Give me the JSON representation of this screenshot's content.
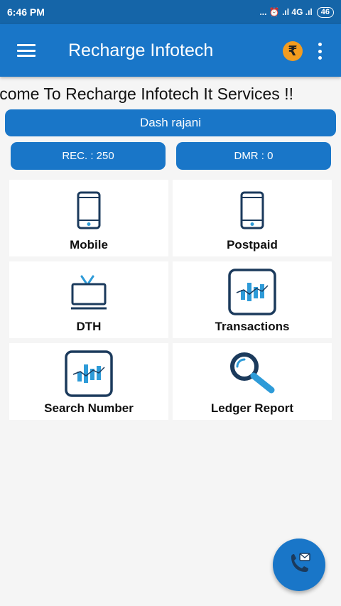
{
  "status_bar": {
    "time": "6:46 PM",
    "indicators": "... ⏰ .ıl 4G .ıl",
    "battery": "46"
  },
  "app_bar": {
    "title": "Recharge Infotech",
    "menu_icon": "hamburger-icon",
    "wallet_icon": "rupee-icon",
    "wallet_symbol": "₹",
    "more_icon": "more-vert-icon"
  },
  "marquee": {
    "text": "Welcome To Recharge Infotech It Services !!"
  },
  "user": {
    "name": "Dash rajani"
  },
  "balances": {
    "rec": "REC. : 250",
    "dmr": "DMR : 0"
  },
  "tiles": [
    {
      "label": "Mobile",
      "icon": "mobile-phone-icon"
    },
    {
      "label": "Postpaid",
      "icon": "mobile-phone-icon"
    },
    {
      "label": "DTH",
      "icon": "tv-icon"
    },
    {
      "label": "Transactions",
      "icon": "chart-icon"
    },
    {
      "label": "Search Number",
      "icon": "chart-icon"
    },
    {
      "label": "Ledger Report",
      "icon": "magnifier-icon"
    }
  ],
  "fab": {
    "icon": "phone-message-icon"
  },
  "colors": {
    "primary": "#1976c8",
    "status_bar": "#1565a8",
    "icon_navy": "#1b3a5c",
    "icon_accent": "#2e9bd8",
    "rupee": "#f39c1f"
  }
}
